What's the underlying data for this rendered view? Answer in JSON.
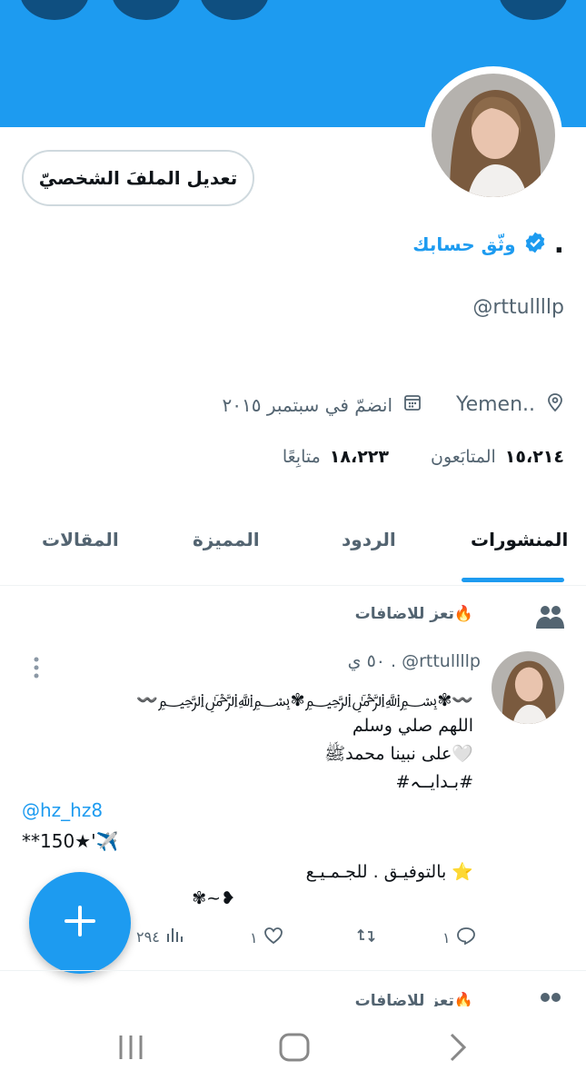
{
  "profile": {
    "edit_button": "تعديل الملفَ الشخصيّ",
    "name_dot": ".",
    "verify_text": "وثّق حسابك",
    "handle": "@rttullllp",
    "location": "Yemen..",
    "joined": "انضمّ في سبتمبر ٢٠١٥",
    "followers_count": "١٥،٢١٤",
    "followers_label": "المتابَعون",
    "following_count": "١٨،٢٢٣",
    "following_label": "متابِعًا"
  },
  "tabs": [
    {
      "label": "المنشورات",
      "active": true
    },
    {
      "label": "الردود",
      "active": false
    },
    {
      "label": "المميزة",
      "active": false
    },
    {
      "label": "المقالات",
      "active": false
    }
  ],
  "post": {
    "context": "تعز للاضافات🔥",
    "author": ". @rttullllp",
    "time": "٥٠ ي",
    "lines": [
      "〰️﷽✾﷽✾〰️",
      "اللهم صلي وسلم",
      "على نبينا ﻣﺤﻤﺪﷺ🤍",
      "#بـدايــہ#"
    ],
    "mention": "@hz_hz8",
    "line_ltr": "**150★'✈️",
    "closing": "بالتوفيـق . للجـمـيـع ⭐",
    "ornament": "✾~❥",
    "replies": "١",
    "reposts": "",
    "likes": "١",
    "views": "٢٩٤"
  },
  "next_post": {
    "context": "تعز للاضافات🔥"
  },
  "colors": {
    "accent": "#1d9bf0",
    "banner": "#1d9bf0",
    "muted": "#536471"
  }
}
